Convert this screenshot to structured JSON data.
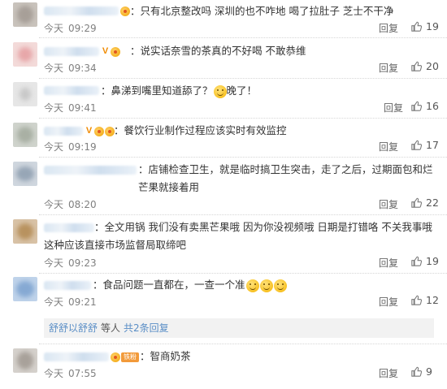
{
  "comments": [
    {
      "text": "：只有北京整改吗 深圳的也不咋地 喝了拉肚子 芝士不干净",
      "day": "今天",
      "time": "09:29",
      "reply": "回复",
      "likes": "19"
    },
    {
      "text": "：说实话奈雪的茶真的不好喝 不敢恭维",
      "day": "今天",
      "time": "09:34",
      "reply": "回复",
      "likes": "20"
    },
    {
      "text": "：鼻涕到嘴里知道舔了？",
      "text2": "晚了！",
      "day": "今天",
      "time": "09:41",
      "reply": "回复",
      "likes": "16"
    },
    {
      "text": "：餐饮行业制作过程应该实时有效监控",
      "day": "今天",
      "time": "09:19",
      "reply": "回复",
      "likes": "17"
    },
    {
      "text": "：店铺检查卫生，就是临时搞卫生突击，走了之后，过期面包和烂芒果就接着用",
      "day": "今天",
      "time": "08:20",
      "reply": "回复",
      "likes": "22"
    },
    {
      "text": "：全文用锅 我们没有卖黑芒果哦 因为你没视频哦 日期是打错咯 不关我事哦 这种应该直接市场监督局取缔吧",
      "day": "今天",
      "time": "09:23",
      "reply": "回复",
      "likes": "19"
    },
    {
      "text": "：食品问题一直都在，一查一个准",
      "day": "今天",
      "time": "09:21",
      "reply": "回复",
      "likes": "12"
    },
    {
      "text": "：智商奶茶",
      "day": "今天",
      "time": "07:55",
      "reply": "回复",
      "likes": "9"
    }
  ],
  "subreply": {
    "user": "舒舒以舒舒",
    "mid": "等人",
    "link": "共2条回复"
  },
  "badges": {
    "fan_tag": "铁粉"
  },
  "colors": {
    "link": "#5a8ec6",
    "meta": "#808080",
    "badge_orange": "#f08a00"
  }
}
